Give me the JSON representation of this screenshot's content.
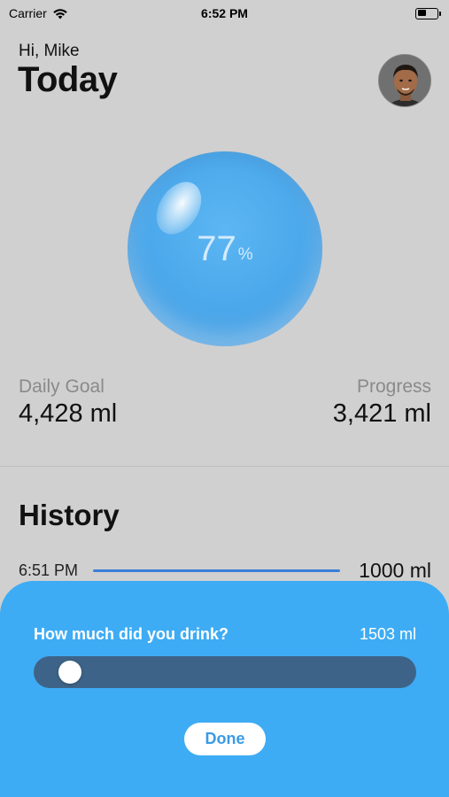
{
  "status_bar": {
    "carrier": "Carrier",
    "time": "6:52 PM",
    "wifi_icon": "wifi-icon",
    "battery_icon": "battery-icon"
  },
  "header": {
    "greeting": "Hi, Mike",
    "title": "Today",
    "avatar_icon": "user-avatar"
  },
  "progress_bubble": {
    "percent_value": "77",
    "percent_sign": "%",
    "fill_fraction": 0.77
  },
  "stats": {
    "goal_label": "Daily Goal",
    "goal_value": "4,428 ml",
    "progress_label": "Progress",
    "progress_value": "3,421 ml"
  },
  "history": {
    "title": "History",
    "entries": [
      {
        "time": "6:51 PM",
        "amount": "1000 ml"
      }
    ]
  },
  "drink_sheet": {
    "question": "How much did you drink?",
    "amount": "1503 ml",
    "done_label": "Done"
  },
  "colors": {
    "background": "#d0d0d0",
    "bubble": "#4aa7ea",
    "sheet": "#3eacf4",
    "slider_track": "#3d6488",
    "history_bar": "#3a7fd8",
    "done_text": "#3a9be6"
  }
}
